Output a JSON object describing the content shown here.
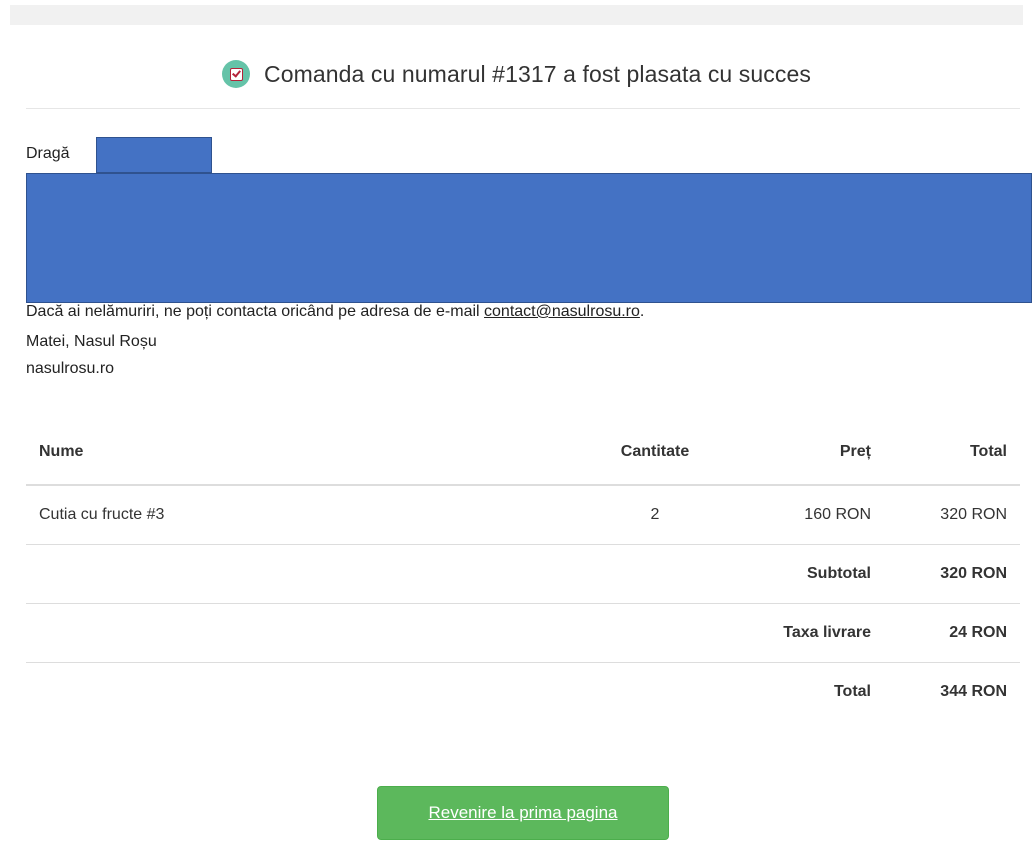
{
  "header": {
    "icon": "checkbox-icon",
    "title": "Comanda cu numarul #1317 a fost plasata cu succes"
  },
  "message": {
    "greeting": "Dragă",
    "contact_text": "Dacă ai nelămuriri, ne poți contacta oricând pe adresa de e-mail ",
    "contact_email": "contact@nasulrosu.ro",
    "contact_suffix": ".",
    "signature_name": "Matei, Nasul Roșu",
    "signature_site": "nasulrosu.ro"
  },
  "table": {
    "headers": {
      "name": "Nume",
      "quantity": "Cantitate",
      "price": "Preț",
      "total": "Total"
    },
    "rows": [
      {
        "name": "Cutia cu fructe #3",
        "quantity": "2",
        "price": "160 RON",
        "total": "320 RON"
      }
    ],
    "summary": [
      {
        "label": "Subtotal",
        "value": "320 RON"
      },
      {
        "label": "Taxa livrare",
        "value": "24 RON"
      },
      {
        "label": "Total",
        "value": "344 RON"
      }
    ]
  },
  "actions": {
    "home_button": "Revenire la prima pagina"
  },
  "colors": {
    "button_green": "#5cb85c",
    "icon_teal": "#65c3a8",
    "redaction_blue": "#4472c4"
  }
}
